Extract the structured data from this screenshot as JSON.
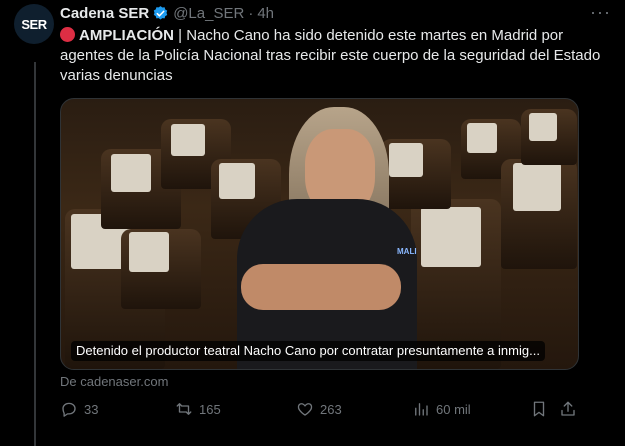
{
  "account": {
    "avatar_text": "SER",
    "name": "Cadena SER",
    "handle": "@La_SER",
    "separator": "·",
    "time": "4h"
  },
  "tweet": {
    "tag": "AMPLIACIÓN",
    "text": " | Nacho Cano ha sido detenido este martes en Madrid por agentes de la Policía Nacional tras recibir este cuerpo de la seguridad del Estado varias denuncias"
  },
  "media": {
    "caption": "Detenido el productor teatral Nacho Cano por contratar presuntamente a inmig...",
    "shirt_logo": "MALI"
  },
  "source": "De cadenaser.com",
  "actions": {
    "replies": "33",
    "reposts": "165",
    "likes": "263",
    "views": "60 mil"
  },
  "colors": {
    "background": "#000000",
    "text": "#e7e9ea",
    "muted": "#71767b",
    "verified": "#1d9bf0",
    "alert": "#dd2e44"
  }
}
